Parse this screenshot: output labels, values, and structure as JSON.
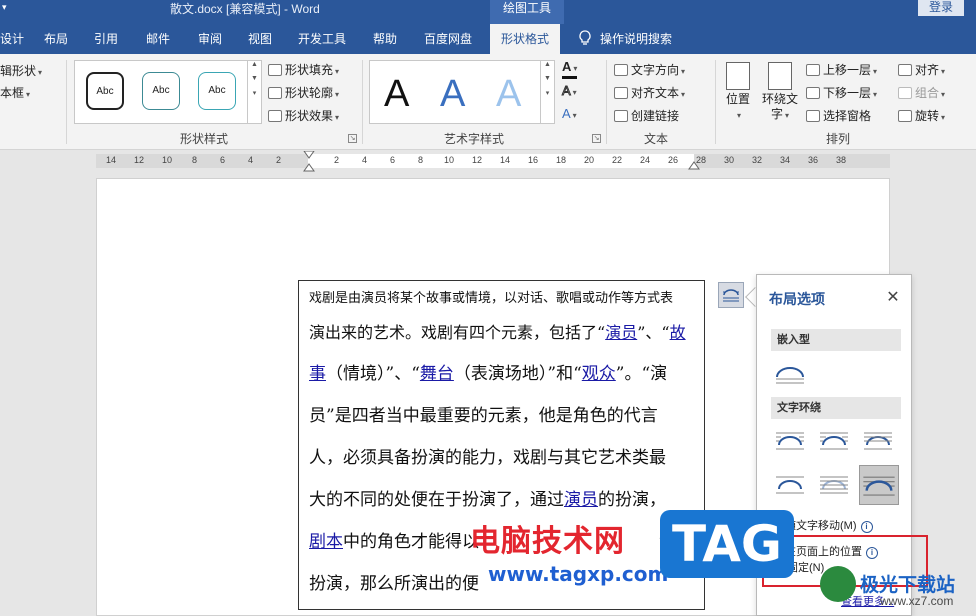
{
  "window": {
    "doc_title": "散文.docx [兼容模式]  -  Word",
    "context_title": "绘图工具",
    "login": "登录"
  },
  "tabs": [
    {
      "label": "设计"
    },
    {
      "label": "布局"
    },
    {
      "label": "引用"
    },
    {
      "label": "邮件"
    },
    {
      "label": "审阅"
    },
    {
      "label": "视图"
    },
    {
      "label": "开发工具"
    },
    {
      "label": "帮助"
    },
    {
      "label": "百度网盘"
    },
    {
      "label": "形状格式"
    }
  ],
  "tell_me": "操作说明搜索",
  "ribbon": {
    "insert_shapes": {
      "edit_shape": "辑形状",
      "text_box": "本框"
    },
    "shape_styles": {
      "label": "形状样式",
      "thumb": "Abc",
      "fill": "形状填充",
      "outline": "形状轮廓",
      "effects": "形状效果"
    },
    "wordart": {
      "label": "艺术字样式",
      "letter": "A"
    },
    "text": {
      "label": "文本",
      "direction": "文字方向",
      "align": "对齐文本",
      "link": "创建链接"
    },
    "arrange": {
      "label": "排列",
      "position": "位置",
      "wrap_line1": "环绕文",
      "wrap_line2": "字",
      "bring_forward": "上移一层",
      "send_backward": "下移一层",
      "selection_pane": "选择窗格",
      "align": "对齐",
      "group": "组合",
      "rotate": "旋转"
    }
  },
  "ruler": [
    "14",
    "12",
    "10",
    "8",
    "6",
    "4",
    "2",
    "2",
    "4",
    "6",
    "8",
    "10",
    "12",
    "14",
    "16",
    "18",
    "20",
    "22",
    "24",
    "26",
    "28",
    "30",
    "32",
    "34",
    "36",
    "38"
  ],
  "textbox": {
    "line1": "戏剧是由演员将某个故事或情境，以对话、歌唱或动作等方式表",
    "line2_a": "演出来的艺术。戏剧有四个元素，包括了“",
    "line2_l1": "演员",
    "line2_b": "”、“",
    "line2_l2": "故",
    "line3_l1": "事",
    "line3_a": "（情境）”、“",
    "line3_l2": "舞台",
    "line3_b": "（表演场地）”和“",
    "line3_l3": "观众",
    "line3_c": "”。“演",
    "line4": "员”是四者当中最重要的元素，他是角色的代言",
    "line5": "人，必须具备扮演的能力，戏剧与其它艺术类最",
    "line6_a": "大的不同的处便在于扮演了，通过",
    "line6_l": "演员",
    "line6_b": "的扮演，",
    "line7_l": "剧本",
    "line7_a": "中的角色才能得以",
    "line7_b": "演员",
    "line8": "扮演，那么所演出的便"
  },
  "layout_panel": {
    "title": "布局选项",
    "inline_section": "嵌入型",
    "wrap_section": "文字环绕",
    "move_with_text": "随文字移动(M)",
    "fix_position_1": "在页面上的位置",
    "fix_position_2": "固定(N)",
    "see_more": "查看更多..."
  },
  "watermarks": {
    "cn": "电脑技术网",
    "url": "www.tagxp.com",
    "tag": "TAG",
    "site": "极光下载站",
    "site_url": "www.xz7.com"
  },
  "colors": {
    "brand": "#2b579a",
    "highlight": "#d9232e"
  }
}
